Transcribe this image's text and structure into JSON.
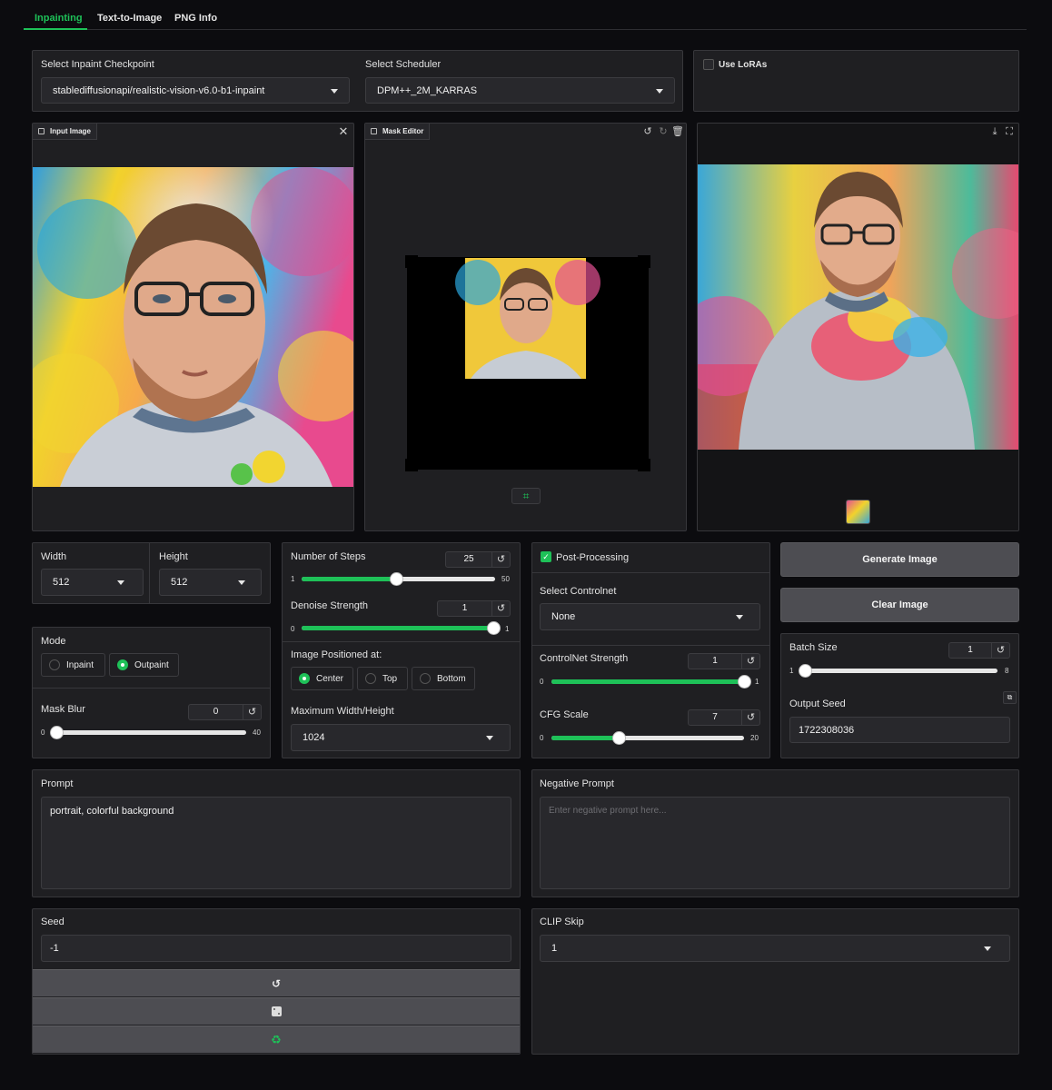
{
  "tabs": [
    {
      "label": "Inpainting",
      "active": true
    },
    {
      "label": "Text-to-Image",
      "active": false
    },
    {
      "label": "PNG Info",
      "active": false
    }
  ],
  "checkpoint": {
    "label": "Select Inpaint Checkpoint",
    "value": "stablediffusionapi/realistic-vision-v6.0-b1-inpaint"
  },
  "scheduler": {
    "label": "Select Scheduler",
    "value": "DPM++_2M_KARRAS"
  },
  "loras": {
    "label": "Use LoRAs",
    "checked": false
  },
  "input_image": {
    "label": "Input Image"
  },
  "mask_editor": {
    "label": "Mask Editor"
  },
  "width": {
    "label": "Width",
    "value": "512"
  },
  "height": {
    "label": "Height",
    "value": "512"
  },
  "mode": {
    "label": "Mode",
    "options": [
      "Inpaint",
      "Outpaint"
    ],
    "selected": "Outpaint"
  },
  "mask_blur": {
    "label": "Mask Blur",
    "value": "0",
    "min": "0",
    "max": "40",
    "fraction": 0.0
  },
  "steps": {
    "label": "Number of Steps",
    "value": "25",
    "min": "1",
    "max": "50",
    "fraction": 0.49
  },
  "denoise": {
    "label": "Denoise Strength",
    "value": "1",
    "min": "0",
    "max": "1",
    "fraction": 1.0
  },
  "position": {
    "label": "Image Positioned at:",
    "options": [
      "Center",
      "Top",
      "Bottom"
    ],
    "selected": "Center"
  },
  "max_wh": {
    "label": "Maximum Width/Height",
    "value": "1024"
  },
  "post_processing": {
    "label": "Post-Processing",
    "checked": true
  },
  "controlnet": {
    "label": "Select Controlnet",
    "value": "None"
  },
  "controlnet_strength": {
    "label": "ControlNet Strength",
    "value": "1",
    "min": "0",
    "max": "1",
    "fraction": 1.0
  },
  "cfg": {
    "label": "CFG Scale",
    "value": "7",
    "min": "0",
    "max": "20",
    "fraction": 0.35
  },
  "generate_label": "Generate Image",
  "clear_label": "Clear Image",
  "batch_size": {
    "label": "Batch Size",
    "value": "1",
    "min": "1",
    "max": "8",
    "fraction": 0.0
  },
  "output_seed": {
    "label": "Output Seed",
    "value": "1722308036"
  },
  "prompt": {
    "label": "Prompt",
    "value": "portrait, colorful background"
  },
  "negative_prompt": {
    "label": "Negative Prompt",
    "placeholder": "Enter negative prompt here..."
  },
  "seed": {
    "label": "Seed",
    "value": "-1"
  },
  "clip_skip": {
    "label": "CLIP Skip",
    "value": "1"
  },
  "seed_buttons": [
    "reset-icon",
    "dice-icon",
    "recycle-icon"
  ],
  "colors": {
    "accent": "#1ec158",
    "panel": "#1f1f22",
    "background": "#0c0c0f"
  }
}
